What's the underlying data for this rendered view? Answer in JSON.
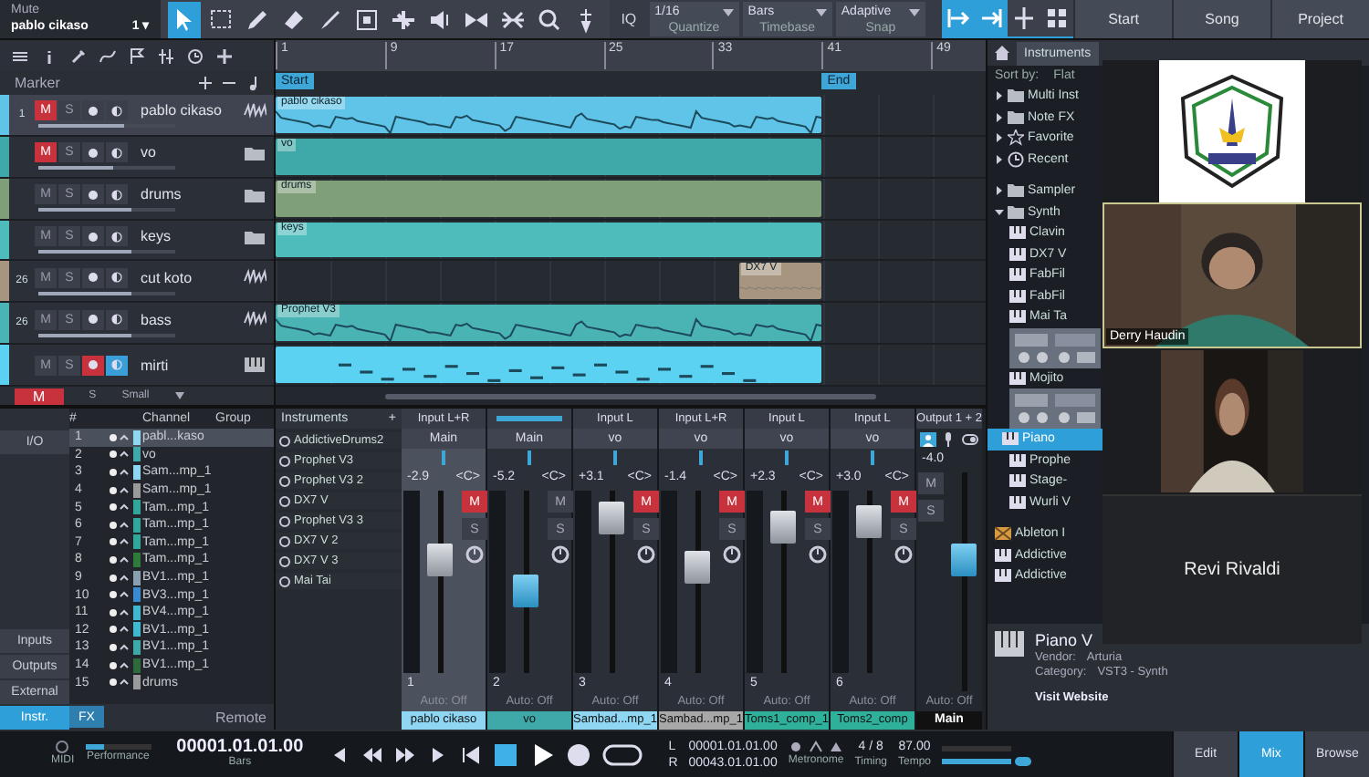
{
  "toolbar": {
    "song_label": "Mute",
    "song_name": "pablo cikaso",
    "song_number": "1",
    "song_caret": "▾",
    "tools": [
      {
        "selected": true
      },
      {
        "selected": false
      },
      {
        "selected": false
      },
      {
        "selected": false
      },
      {
        "selected": false
      },
      {
        "selected": false
      },
      {
        "selected": false
      },
      {
        "selected": false
      },
      {
        "selected": false
      },
      {
        "selected": false
      },
      {
        "selected": false
      },
      {
        "selected": false
      }
    ],
    "iq": "IQ",
    "selectors": [
      {
        "value": "1/16",
        "label": "Quantize"
      },
      {
        "value": "Bars",
        "label": "Timebase"
      },
      {
        "value": "Adaptive",
        "label": "Snap"
      }
    ],
    "snap_tools": [
      {
        "selected": true
      },
      {
        "selected": true
      },
      {
        "selected": false
      },
      {
        "selected": false
      }
    ],
    "pages": [
      "Start",
      "Song",
      "Project"
    ]
  },
  "arrange": {
    "marker_label": "Marker",
    "ruler_marks": [
      {
        "bar": "1"
      },
      {
        "bar": "9"
      },
      {
        "bar": "17"
      },
      {
        "bar": "25"
      },
      {
        "bar": "33"
      },
      {
        "bar": "41"
      },
      {
        "bar": "49"
      }
    ],
    "loop_start": {
      "label": "Start"
    },
    "loop_end": {
      "label": "End"
    },
    "tracks": [
      {
        "number": "1",
        "name": "pablo cikaso",
        "kind": "audio",
        "color": "#5fc4e8",
        "selected": true,
        "muted": true,
        "armed": false,
        "monitor": false,
        "level": 0.62,
        "mute_label": "M",
        "solo_label": "S",
        "clip": {
          "label": "pablo cikaso"
        }
      },
      {
        "name": "vo",
        "kind": "folder",
        "color": "#3fa8a8",
        "selected": false,
        "muted": true,
        "armed": false,
        "monitor": false,
        "level": 0.55,
        "mute_label": "M",
        "solo_label": "S",
        "clip": {
          "label": "vo"
        }
      },
      {
        "name": "drums",
        "kind": "folder",
        "color": "#7f9f78",
        "selected": false,
        "muted": false,
        "armed": false,
        "monitor": false,
        "level": 0.68,
        "mute_label": "M",
        "solo_label": "S",
        "clip": {
          "label": "drums"
        }
      },
      {
        "name": "keys",
        "kind": "folder",
        "color": "#4fbcbc",
        "selected": false,
        "muted": false,
        "armed": false,
        "monitor": false,
        "level": 0.68,
        "mute_label": "M",
        "solo_label": "S",
        "clip": {
          "label": "keys"
        }
      },
      {
        "number": "26",
        "name": "cut koto",
        "kind": "audio",
        "color": "#a89580",
        "selected": false,
        "muted": false,
        "armed": false,
        "monitor": false,
        "level": 0.68,
        "mute_label": "M",
        "solo_label": "S",
        "clip": {
          "label": "DX7 V"
        }
      },
      {
        "number": "26",
        "name": "bass",
        "kind": "audio",
        "color": "#4ab3b3",
        "selected": false,
        "muted": false,
        "armed": false,
        "monitor": false,
        "level": 0.68,
        "mute_label": "M",
        "solo_label": "S",
        "clip": {
          "label": "Prophet V3"
        }
      },
      {
        "name": "mirti",
        "kind": "instrument",
        "color": "#5cd2f2",
        "selected": false,
        "muted": false,
        "armed": true,
        "monitor": true,
        "mute_label": "M",
        "solo_label": "S",
        "clip": {
          "kind": "notes"
        }
      }
    ],
    "footer": {
      "mute": "M",
      "solo": "S",
      "size": "Small"
    }
  },
  "channel_list": {
    "side_buttons": [
      {
        "label": "I/O",
        "selected": false
      },
      {
        "label": "Inputs",
        "selected": false
      },
      {
        "label": "Outputs",
        "selected": false
      },
      {
        "label": "External",
        "selected": false
      },
      {
        "label": "Instr.",
        "selected": true
      }
    ],
    "columns": [
      "#",
      "Channel",
      "Group"
    ],
    "rows": [
      {
        "number": "1",
        "name": "pabl...kaso",
        "color": "#8fd6f2",
        "selected": true
      },
      {
        "number": "2",
        "name": "vo",
        "color": "#3fa8a8",
        "selected": false
      },
      {
        "number": "3",
        "name": "Sam...mp_1",
        "color": "#8fd6f2",
        "selected": false
      },
      {
        "number": "4",
        "name": "Sam...mp_1",
        "color": "#9a9a9a",
        "selected": false
      },
      {
        "number": "5",
        "name": "Tam...mp_1",
        "color": "#2fa89a",
        "selected": false
      },
      {
        "number": "6",
        "name": "Tam...mp_1",
        "color": "#2fa89a",
        "selected": false
      },
      {
        "number": "7",
        "name": "Tam...mp_1",
        "color": "#2fa89a",
        "selected": false
      },
      {
        "number": "8",
        "name": "Tam...mp_1",
        "color": "#2f7a3a",
        "selected": false
      },
      {
        "number": "9",
        "name": "BV1...mp_1",
        "color": "#8aa0b0",
        "selected": false
      },
      {
        "number": "10",
        "name": "BV3...mp_1",
        "color": "#3a8ad0",
        "selected": false
      },
      {
        "number": "11",
        "name": "BV4...mp_1",
        "color": "#3fb8d0",
        "selected": false
      },
      {
        "number": "12",
        "name": "BV1...mp_1",
        "color": "#3fb8d0",
        "selected": false
      },
      {
        "number": "13",
        "name": "BV1...mp_1",
        "color": "#3fa8a8",
        "selected": false
      },
      {
        "number": "14",
        "name": "BV1...mp_1",
        "color": "#2f6a3a",
        "selected": false
      },
      {
        "number": "15",
        "name": "drums",
        "color": "#9a9a9a",
        "selected": false
      }
    ],
    "bottom_buttons": [
      "FX"
    ],
    "remote": "Remote"
  },
  "instruments": {
    "title": "Instruments",
    "add": "+",
    "items": [
      "AddictiveDrums2",
      "Prophet V3",
      "Prophet V3 2",
      "DX7 V",
      "Prophet V3 3",
      "DX7 V 2",
      "DX7 V 3",
      "Mai Tai"
    ]
  },
  "mixer": {
    "channels": [
      {
        "input": "Input L+R",
        "output": "Main",
        "value": "-2.9",
        "pan": "<C>",
        "muted": true,
        "selected": true,
        "number": "1",
        "automation": "Auto: Off",
        "name": "pablo cikaso",
        "color": "#8fd6f2",
        "level": 0.62,
        "mute_label": "M",
        "solo_label": "S"
      },
      {
        "output": "Main",
        "value": "-5.2",
        "pan": "<C>",
        "muted": false,
        "selected": false,
        "number": "2",
        "automation": "Auto: Off",
        "name": "vo",
        "color": "#3fa8a8",
        "level": 0.45,
        "mute_label": "M",
        "solo_label": "S"
      },
      {
        "input": "Input L",
        "output": "vo",
        "value": "+3.1",
        "pan": "<C>",
        "muted": true,
        "selected": false,
        "number": "3",
        "automation": "Auto: Off",
        "name": "Sambad...mp_1",
        "color": "#8fd6f2",
        "level": 0.85,
        "mute_label": "M",
        "solo_label": "S"
      },
      {
        "input": "Input L+R",
        "output": "vo",
        "value": "-1.4",
        "pan": "<C>",
        "muted": true,
        "selected": false,
        "number": "4",
        "automation": "Auto: Off",
        "name": "Sambad...mp_1",
        "color": "#a8a8a8",
        "level": 0.58,
        "mute_label": "M",
        "solo_label": "S"
      },
      {
        "input": "Input L",
        "output": "vo",
        "value": "+2.3",
        "pan": "<C>",
        "muted": true,
        "selected": false,
        "number": "5",
        "automation": "Auto: Off",
        "name": "Toms1_comp_1",
        "color": "#2fb09a",
        "level": 0.8,
        "mute_label": "M",
        "solo_label": "S"
      },
      {
        "input": "Input L",
        "output": "vo",
        "value": "+3.0",
        "pan": "<C>",
        "muted": true,
        "selected": false,
        "number": "6",
        "automation": "Auto: Off",
        "name": "Toms2_comp",
        "color": "#2fb09a",
        "level": 0.83,
        "mute_label": "M",
        "solo_label": "S"
      }
    ],
    "main": {
      "input": "Output 1 + 2",
      "value": "-4.0",
      "automation": "Auto: Off",
      "name": "Main",
      "level": 0.6,
      "mute_label": "M",
      "solo_label": "S"
    }
  },
  "browser": {
    "tabs": [
      {
        "label": "Instruments",
        "selected": true
      }
    ],
    "sort_label": "Sort by:",
    "sort_value": "Flat",
    "tree": [
      {
        "label": "Multi Inst",
        "kind": "folder",
        "expanded": false
      },
      {
        "label": "Note FX",
        "kind": "folder",
        "expanded": false
      },
      {
        "label": "Favorite",
        "kind": "star",
        "expanded": false
      },
      {
        "label": "Recent",
        "kind": "clock",
        "expanded": false
      },
      {
        "label": "Sampler",
        "kind": "folder",
        "expanded": false
      },
      {
        "label": "Synth",
        "kind": "folder",
        "expanded": true,
        "children": [
          {
            "label": "Clavin",
            "kind": "plugin",
            "selected": false
          },
          {
            "label": "DX7 V",
            "kind": "plugin",
            "selected": false
          },
          {
            "label": "FabFil",
            "kind": "plugin",
            "selected": false
          },
          {
            "label": "FabFil",
            "kind": "plugin",
            "selected": false
          },
          {
            "label": "Mai Ta",
            "kind": "plugin",
            "selected": false
          },
          {
            "kind": "thumbnail"
          },
          {
            "label": "Mojito",
            "kind": "plugin",
            "selected": false
          },
          {
            "kind": "thumbnail"
          },
          {
            "label": "Piano",
            "kind": "plugin",
            "selected": true
          },
          {
            "label": "Prophe",
            "kind": "plugin",
            "selected": false
          },
          {
            "label": "Stage-",
            "kind": "plugin",
            "selected": false
          },
          {
            "label": "Wurli V",
            "kind": "plugin",
            "selected": false
          }
        ]
      },
      {
        "label": "Ableton I",
        "kind": "package"
      },
      {
        "label": "Addictive",
        "kind": "plugin"
      },
      {
        "label": "Addictive",
        "kind": "plugin"
      }
    ],
    "info": {
      "title": "Piano V",
      "fields": [
        {
          "label": "Vendor:",
          "value": "Arturia"
        },
        {
          "label": "Category:",
          "value": "VST3 - Synth"
        }
      ],
      "link": "Visit Website"
    }
  },
  "video_call": {
    "tiles": [
      {
        "kind": "logo"
      },
      {
        "kind": "video",
        "name": "Derry Haudin",
        "speaking": true
      },
      {
        "kind": "video",
        "speaking": false
      },
      {
        "kind": "name",
        "name": "Revi Rivaldi"
      }
    ]
  },
  "transport": {
    "midi": "MIDI",
    "performance": "Performance",
    "time": "00001.01.01.00",
    "time_unit": "Bars",
    "left_label": "L",
    "left_time": "00001.01.01.00",
    "right_label": "R",
    "right_time": "00043.01.01.00",
    "loop": false,
    "metronome": "Metronome",
    "signature": "4 / 8",
    "signature_label": "Timing",
    "tempo": "87.00",
    "tempo_label": "Tempo",
    "views": [
      {
        "label": "Edit",
        "selected": false
      },
      {
        "label": "Mix",
        "selected": true
      },
      {
        "label": "Browse",
        "selected": false
      }
    ]
  }
}
